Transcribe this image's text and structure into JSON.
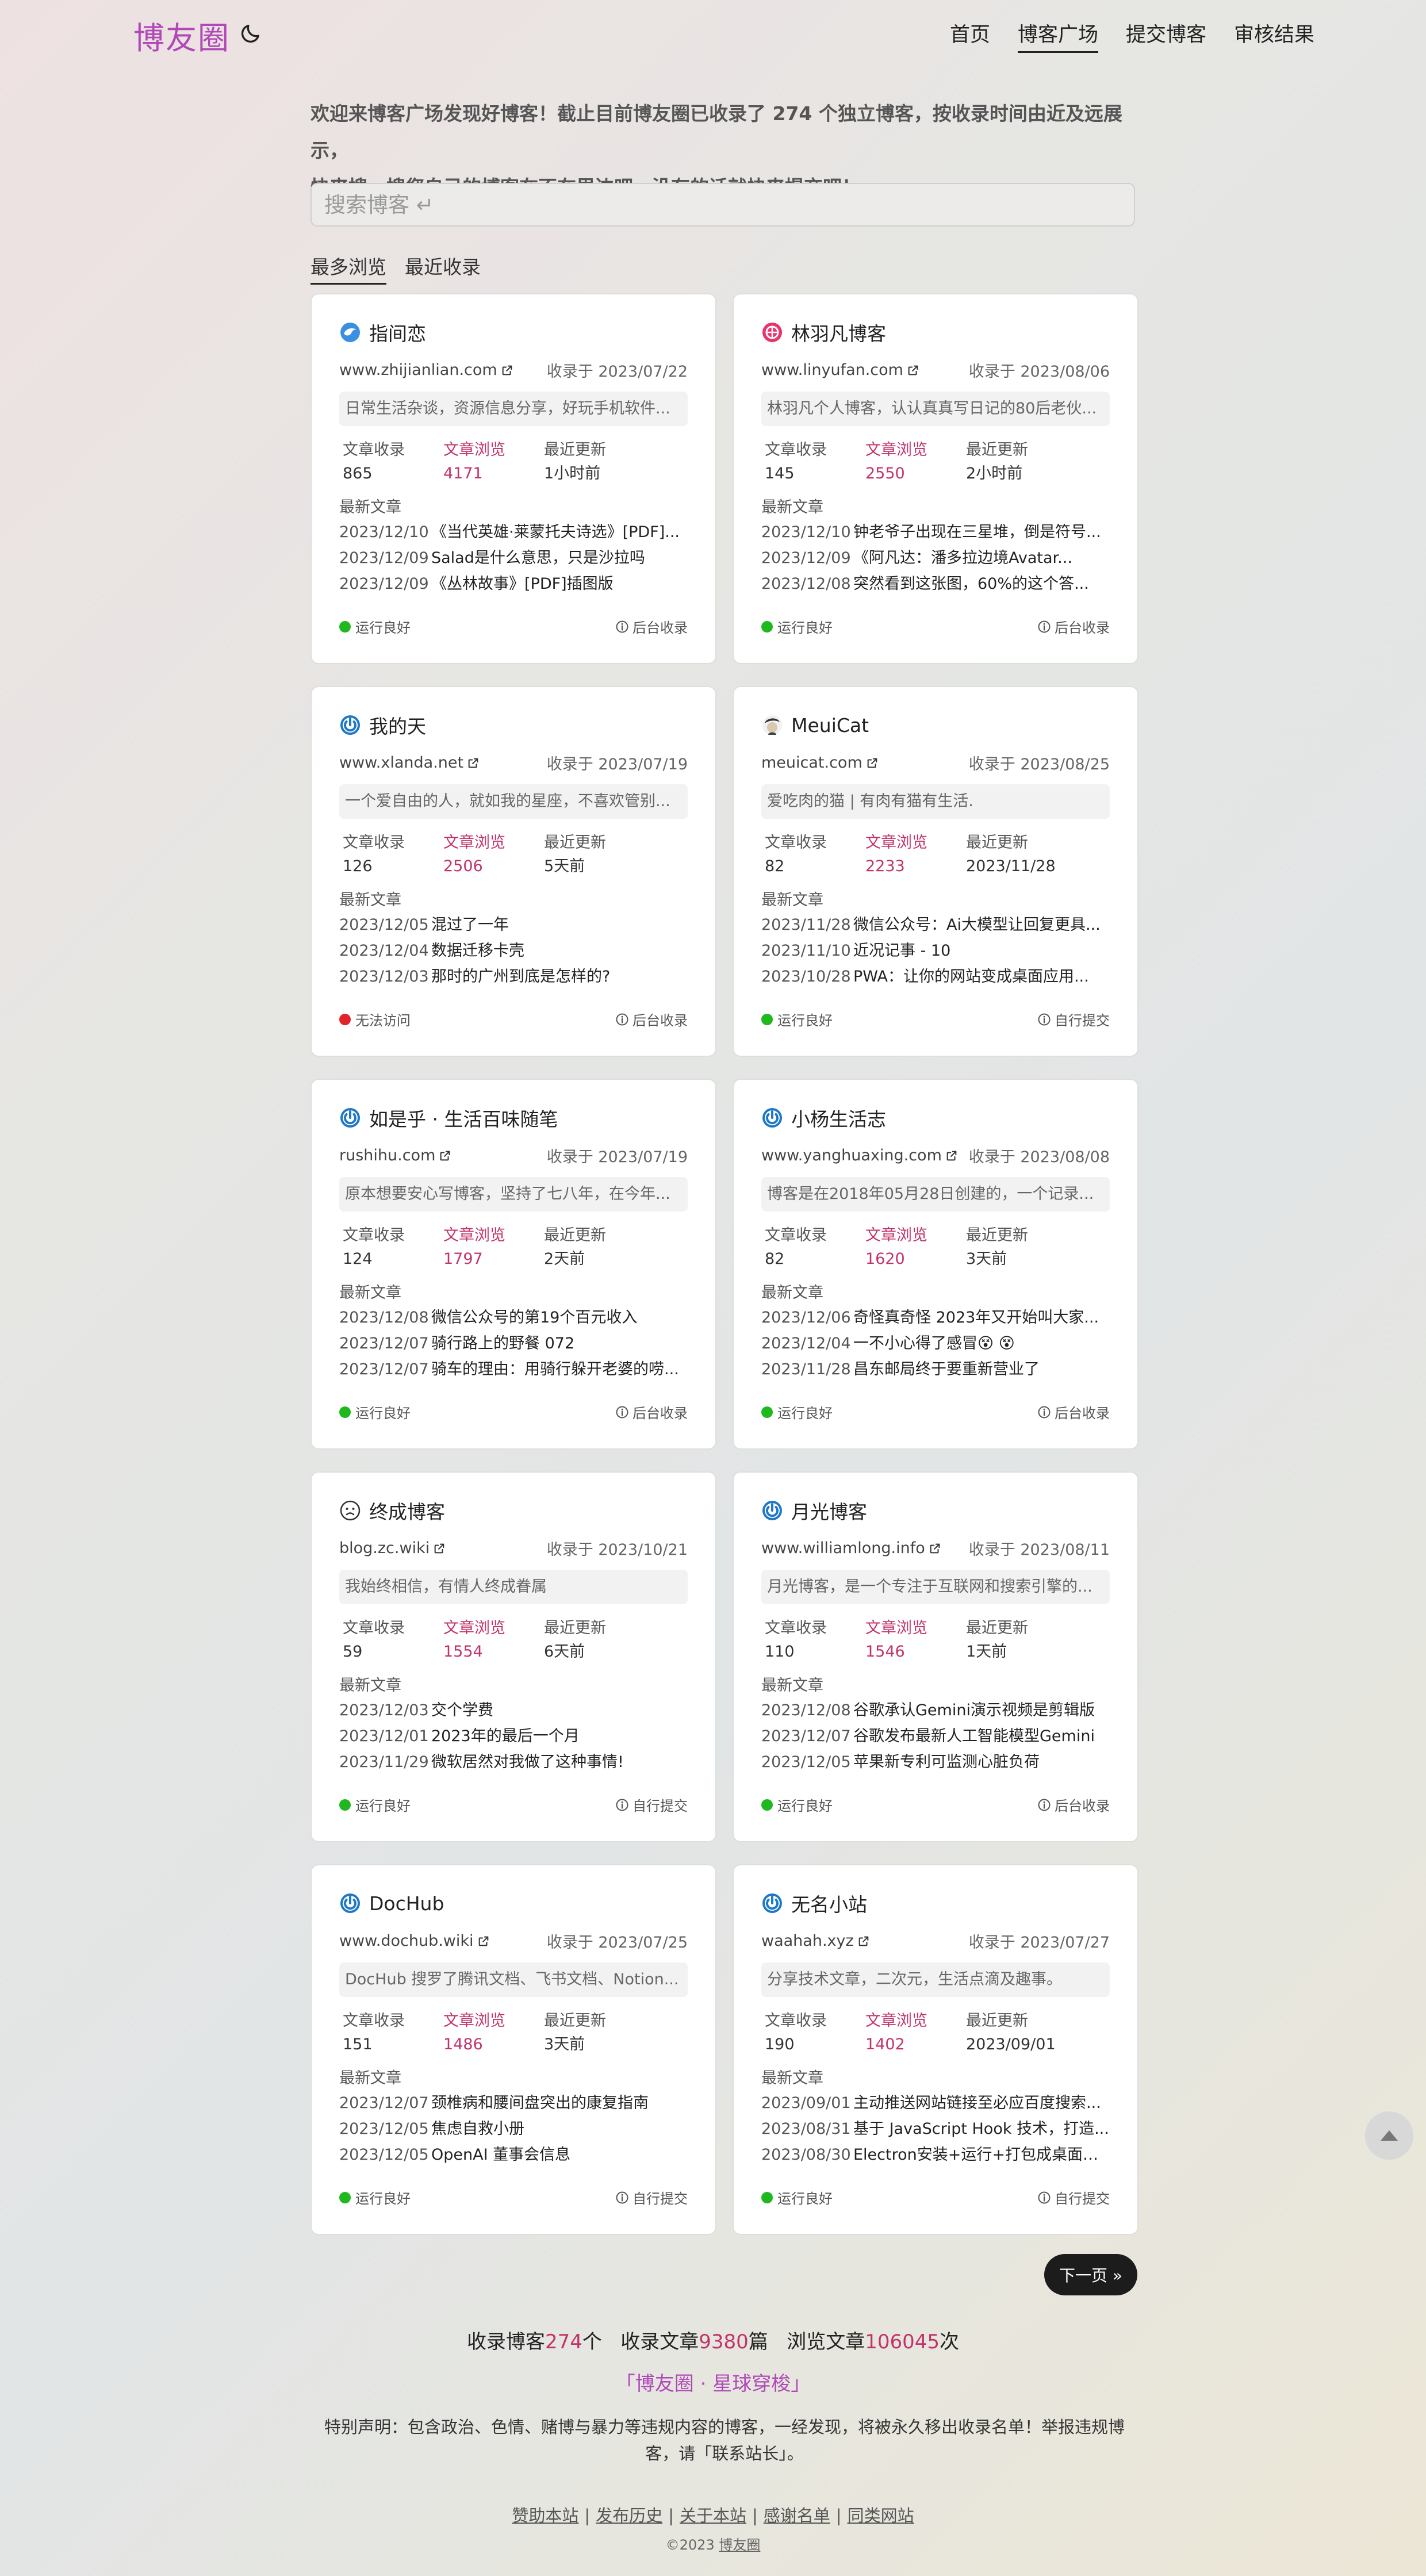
{
  "header": {
    "logo": "博友圈",
    "nav": [
      "首页",
      "博客广场",
      "提交博客",
      "审核结果"
    ]
  },
  "intro": {
    "line1": "欢迎来博客广场发现好博客！截止目前博友圈已收录了 274 个独立博客，按收录时间由近及远展示，",
    "line2": "快来搜一搜您自己的博客在不在里边吧，没有的话就快来提交吧！"
  },
  "search": {
    "placeholder": "搜索博客 ↵"
  },
  "sort_tabs": [
    "最多浏览",
    "最近收录"
  ],
  "labels": {
    "articles": "文章收录",
    "views": "文章浏览",
    "updated": "最近更新",
    "latest": "最新文章"
  },
  "cards": [
    {
      "name": "指间恋",
      "icon": "bird-favicon",
      "url": "www.zhijianlian.com",
      "date": "收录于 2023/07/22",
      "desc": "日常生活杂谈，资源信息分享，好玩手机软件...",
      "articles": "865",
      "views": "4171",
      "updated": "1小时前",
      "posts": [
        {
          "date": "2023/12/10",
          "title": "《当代英雄·莱蒙托夫诗选》[PDF]..."
        },
        {
          "date": "2023/12/09",
          "title": "Salad是什么意思，只是沙拉吗"
        },
        {
          "date": "2023/12/09",
          "title": "《丛林故事》[PDF]插图版"
        }
      ],
      "status": "运行良好",
      "status_type": "good",
      "source": "后台收录"
    },
    {
      "name": "林羽凡博客",
      "icon": "pink-flower-favicon",
      "url": "www.linyufan.com",
      "date": "收录于 2023/08/06",
      "desc": "林羽凡个人博客，认认真真写日记的80后老伙...",
      "articles": "145",
      "views": "2550",
      "updated": "2小时前",
      "posts": [
        {
          "date": "2023/12/10",
          "title": "钟老爷子出现在三星堆，倒是符号..."
        },
        {
          "date": "2023/12/09",
          "title": "《阿凡达：潘多拉边境Avatar..."
        },
        {
          "date": "2023/12/08",
          "title": "突然看到这张图，60%的这个答..."
        }
      ],
      "status": "运行良好",
      "status_type": "good",
      "source": "后台收录"
    },
    {
      "name": "我的天",
      "icon": "power-favicon",
      "url": "www.xlanda.net",
      "date": "收录于 2023/07/19",
      "desc": "一个爱自由的人，就如我的星座，不喜欢管别...",
      "articles": "126",
      "views": "2506",
      "updated": "5天前",
      "posts": [
        {
          "date": "2023/12/05",
          "title": "混过了一年"
        },
        {
          "date": "2023/12/04",
          "title": "数据迁移卡壳"
        },
        {
          "date": "2023/12/03",
          "title": "那时的广州到底是怎样的?"
        }
      ],
      "status": "无法访问",
      "status_type": "bad",
      "source": "后台收录"
    },
    {
      "name": "MeuiCat",
      "icon": "cat-avatar-favicon",
      "url": "meuicat.com",
      "date": "收录于 2023/08/25",
      "desc": "爱吃肉的猫 | 有肉有猫有生活.",
      "articles": "82",
      "views": "2233",
      "updated": "2023/11/28",
      "posts": [
        {
          "date": "2023/11/28",
          "title": "微信公众号：Ai大模型让回复更具..."
        },
        {
          "date": "2023/11/10",
          "title": "近况记事 - 10"
        },
        {
          "date": "2023/10/28",
          "title": "PWA：让你的网站变成桌面应用..."
        }
      ],
      "status": "运行良好",
      "status_type": "good",
      "source": "自行提交"
    },
    {
      "name": "如是乎 · 生活百味随笔",
      "icon": "power-favicon",
      "url": "rushihu.com",
      "date": "收录于 2023/07/19",
      "desc": "原本想要安心写博客，坚持了七八年，在今年...",
      "articles": "124",
      "views": "1797",
      "updated": "2天前",
      "posts": [
        {
          "date": "2023/12/08",
          "title": "微信公众号的第19个百元收入"
        },
        {
          "date": "2023/12/07",
          "title": "骑行路上的野餐 072"
        },
        {
          "date": "2023/12/07",
          "title": "骑车的理由：用骑行躲开老婆的唠..."
        }
      ],
      "status": "运行良好",
      "status_type": "good",
      "source": "后台收录"
    },
    {
      "name": "小杨生活志",
      "icon": "power-favicon",
      "url": "www.yanghuaxing.com",
      "date": "收录于 2023/08/08",
      "desc": "博客是在2018年05月28日创建的，一个记录...",
      "articles": "82",
      "views": "1620",
      "updated": "3天前",
      "posts": [
        {
          "date": "2023/12/06",
          "title": "奇怪真奇怪 2023年又开始叫大家..."
        },
        {
          "date": "2023/12/04",
          "title": "一不小心得了感冒😵 😵"
        },
        {
          "date": "2023/11/28",
          "title": "昌东邮局终于要重新营业了"
        }
      ],
      "status": "运行良好",
      "status_type": "good",
      "source": "后台收录"
    },
    {
      "name": "终成博客",
      "icon": "face-favicon",
      "url": "blog.zc.wiki",
      "date": "收录于 2023/10/21",
      "desc": "我始终相信，有情人终成眷属",
      "articles": "59",
      "views": "1554",
      "updated": "6天前",
      "posts": [
        {
          "date": "2023/12/03",
          "title": "交个学费"
        },
        {
          "date": "2023/12/01",
          "title": "2023年的最后一个月"
        },
        {
          "date": "2023/11/29",
          "title": "微软居然对我做了这种事情!"
        }
      ],
      "status": "运行良好",
      "status_type": "good",
      "source": "自行提交"
    },
    {
      "name": "月光博客",
      "icon": "power-favicon",
      "url": "www.williamlong.info",
      "date": "收录于 2023/08/11",
      "desc": "月光博客，是一个专注于互联网和搜索引擎的...",
      "articles": "110",
      "views": "1546",
      "updated": "1天前",
      "posts": [
        {
          "date": "2023/12/08",
          "title": "谷歌承认Gemini演示视频是剪辑版"
        },
        {
          "date": "2023/12/07",
          "title": "谷歌发布最新人工智能模型Gemini"
        },
        {
          "date": "2023/12/05",
          "title": "苹果新专利可监测心脏负荷"
        }
      ],
      "status": "运行良好",
      "status_type": "good",
      "source": "后台收录"
    },
    {
      "name": "DocHub",
      "icon": "power-favicon",
      "url": "www.dochub.wiki",
      "date": "收录于 2023/07/25",
      "desc": "DocHub 搜罗了腾讯文档、飞书文档、Notion...",
      "articles": "151",
      "views": "1486",
      "updated": "3天前",
      "posts": [
        {
          "date": "2023/12/07",
          "title": "颈椎病和腰间盘突出的康复指南"
        },
        {
          "date": "2023/12/05",
          "title": "焦虑自救小册"
        },
        {
          "date": "2023/12/05",
          "title": "OpenAI 董事会信息"
        }
      ],
      "status": "运行良好",
      "status_type": "good",
      "source": "自行提交"
    },
    {
      "name": "无名小站",
      "icon": "power-favicon",
      "url": "waahah.xyz",
      "date": "收录于 2023/07/27",
      "desc": "分享技术文章，二次元，生活点滴及趣事。",
      "articles": "190",
      "views": "1402",
      "updated": "2023/09/01",
      "posts": [
        {
          "date": "2023/09/01",
          "title": "主动推送网站链接至必应百度搜索..."
        },
        {
          "date": "2023/08/31",
          "title": "基于 JavaScript Hook 技术，打造..."
        },
        {
          "date": "2023/08/30",
          "title": "Electron安装+运行+打包成桌面应..."
        }
      ],
      "status": "运行良好",
      "status_type": "good",
      "source": "自行提交"
    }
  ],
  "pagination": {
    "next": "下一页 »"
  },
  "totals": {
    "blogs_prefix": "收录博客",
    "blogs": "274",
    "blogs_unit": "个",
    "articles_prefix": "收录文章",
    "articles": "9380",
    "articles_unit": "篇",
    "views_prefix": "浏览文章",
    "views": "106045",
    "views_unit": "次"
  },
  "tagline": "「博友圈 · 星球穿梭」",
  "notice": "特别声明：包含政治、色情、赌博与暴力等违规内容的博客，一经发现，将被永久移出收录名单！举报违规博客，请「联系站长」。",
  "footer": {
    "links": [
      "赞助本站",
      "发布历史",
      "关于本站",
      "感谢名单",
      "同类网站"
    ],
    "copyright_prefix": "©2023",
    "copyright_link": "博友圈"
  },
  "colors": {
    "brand": "#b048b8",
    "views": "#c2336b",
    "ok": "#1fb81f",
    "error": "#e0242b"
  }
}
